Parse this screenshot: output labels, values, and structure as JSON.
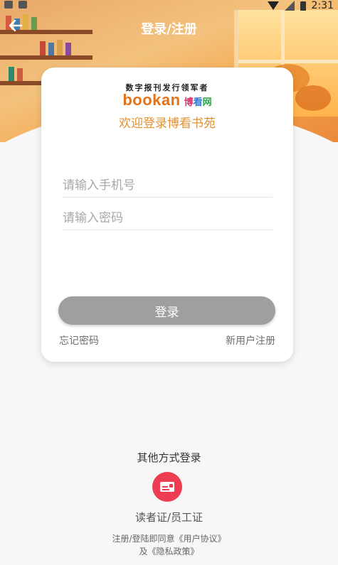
{
  "status_bar": {
    "time": "2:31"
  },
  "header": {
    "title": "登录/注册",
    "back_icon": "arrow-left-icon"
  },
  "brand": {
    "slogan": "数字报刊发行领军者",
    "logo_text": "bookan",
    "logo_cn": [
      "博",
      "看",
      "网"
    ],
    "welcome": "欢迎登录博看书苑",
    "colors": {
      "accent": "#e39132",
      "logo": "#e37218"
    }
  },
  "form": {
    "phone_placeholder": "请输入手机号",
    "phone_value": "",
    "password_placeholder": "请输入密码",
    "password_value": "",
    "login_label": "登录",
    "login_color": "#9f9f9f",
    "forgot_label": "忘记密码",
    "register_label": "新用户注册"
  },
  "other_login": {
    "title": "其他方式登录",
    "methods": [
      {
        "icon": "id-card-icon",
        "label": "读者证/员工证",
        "color": "#ee3c53"
      }
    ]
  },
  "agreement": {
    "line1": "注册/登陆即同意《用户协议》",
    "line2": "及《隐私政策》"
  }
}
